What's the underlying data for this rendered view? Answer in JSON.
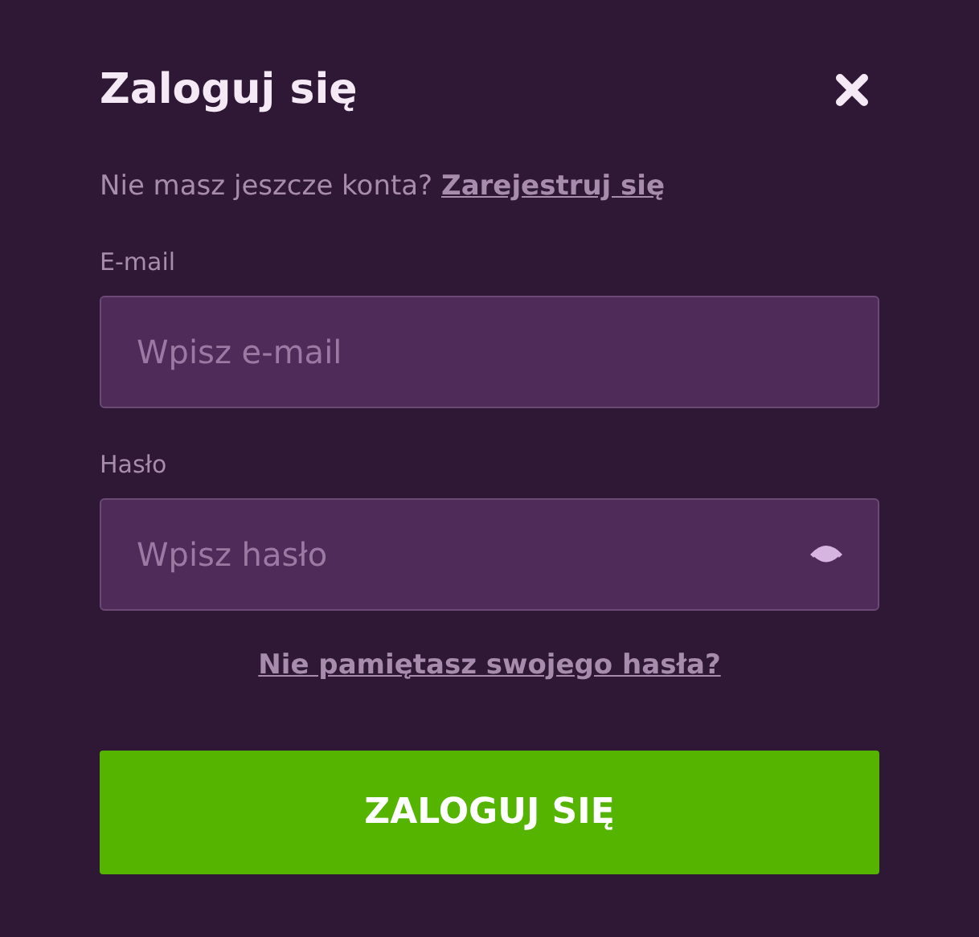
{
  "title": "Zaloguj się",
  "register_prompt": {
    "text": "Nie masz jeszcze konta?",
    "link": "Zarejestruj się"
  },
  "fields": [
    {
      "label": "E-mail",
      "placeholder": "Wpisz e-mail",
      "kind": "email"
    },
    {
      "label": "Hasło",
      "placeholder": "Wpisz hasło",
      "kind": "password"
    }
  ],
  "forgot_link": "Nie pamiętasz swojego hasła?",
  "submit_button": "ZALOGUJ SIĘ"
}
